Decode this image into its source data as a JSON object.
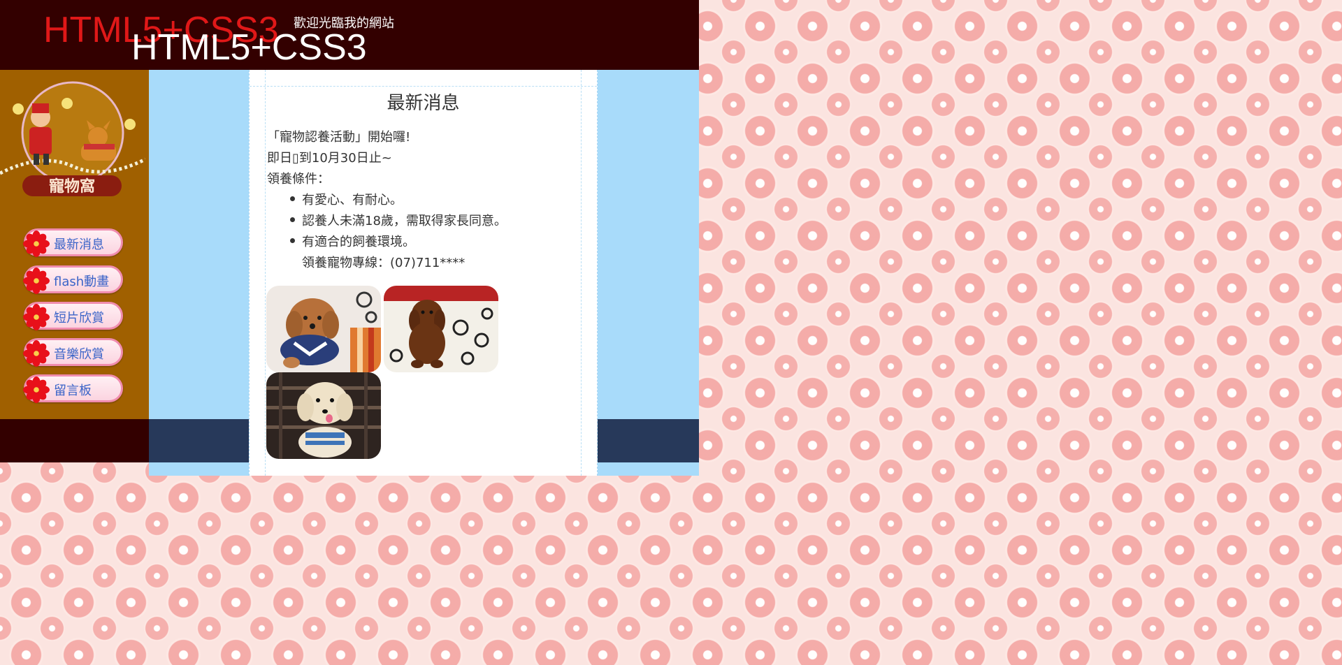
{
  "header": {
    "title": "HTML5+CSS3",
    "title_shadow": "HTML5+CSS3"
  },
  "sidebar": {
    "logo_text": "寵物窩",
    "nav": [
      {
        "label": "最新消息"
      },
      {
        "label": "flash動畫"
      },
      {
        "label": "短片欣賞"
      },
      {
        "label": "音樂欣賞"
      },
      {
        "label": "留言板"
      }
    ]
  },
  "main": {
    "heading": "最新消息",
    "lines": [
      "「寵物認養活動」開始囉!",
      "即日▯到10月30日止~",
      "領養條件："
    ],
    "conditions": [
      "有愛心、有耐心。",
      "認養人未滿18歲，需取得家長同意。",
      "有適合的飼養環境。"
    ],
    "hotline": "領養寵物專線：(07)711****",
    "photos": [
      "dog-photo-1",
      "dog-photo-2",
      "dog-photo-3"
    ]
  },
  "footer": {
    "text": "歡迎光臨我的網站"
  },
  "colors": {
    "header_bg": "#330000",
    "sidebar_bg": "#a06000",
    "strip_bg": "#a8dbfa",
    "footer_blue": "#27395a",
    "title_red": "#e01818",
    "nav_text": "#3a64c8"
  }
}
